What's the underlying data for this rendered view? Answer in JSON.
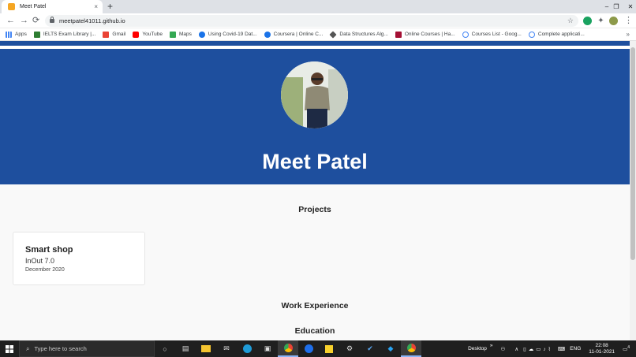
{
  "browser": {
    "tab_title": "Meet Patel",
    "tab_close": "×",
    "new_tab": "+",
    "window_controls": [
      "–",
      "❐",
      "✕"
    ],
    "back": "←",
    "forward": "→",
    "reload": "⟳",
    "url": "meetpatel41011.github.io",
    "star": "☆",
    "menu": "⋮"
  },
  "bookmarks": [
    {
      "label": "Apps",
      "color": "#4285f4"
    },
    {
      "label": "IELTS Exam Library |...",
      "color": "#2e7d32"
    },
    {
      "label": "Gmail",
      "color": "#ea4335"
    },
    {
      "label": "YouTube",
      "color": "#ff0000"
    },
    {
      "label": "Maps",
      "color": "#34a853"
    },
    {
      "label": "Using Covid-19 Dat...",
      "color": "#1a73e8"
    },
    {
      "label": "Coursera | Online C...",
      "color": "#1a73e8"
    },
    {
      "label": "Data Structures Alg...",
      "color": "#555555"
    },
    {
      "label": "Online Courses | Ha...",
      "color": "#a41034"
    },
    {
      "label": "Courses List - Goog...",
      "color": "#4285f4"
    },
    {
      "label": "Complete applicati...",
      "color": "#4285f4"
    }
  ],
  "bookmarks_more": "»",
  "hero": {
    "name": "Meet Patel",
    "bg_color": "#1e4f9e"
  },
  "sections": {
    "projects": "Projects",
    "work": "Work Experience",
    "education": "Education"
  },
  "project_card": {
    "title": "Smart shop",
    "event": "InOut 7.0",
    "date": "December 2020"
  },
  "taskbar": {
    "search_placeholder": "Type here to search",
    "desktop_label": "Desktop",
    "desktop_more": "»",
    "language": "ENG",
    "time": "22:08",
    "date": "11-01-2021",
    "notifications": "4"
  }
}
